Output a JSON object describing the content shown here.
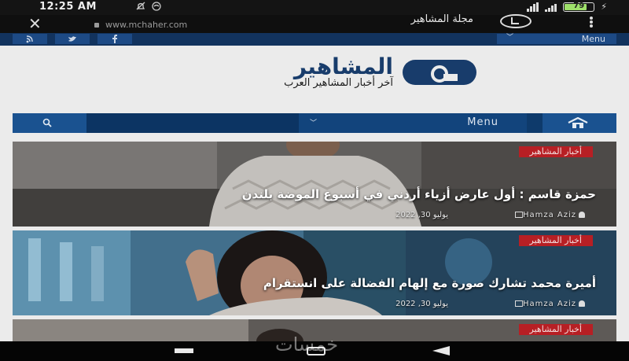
{
  "status_bar": {
    "time": "12:25 AM",
    "battery": "79",
    "battery_level": 0.79
  },
  "browser": {
    "url": "www.mchaher.com",
    "page_name": "مجلة المشاهير"
  },
  "top_strip": {
    "menu_label": "Menu",
    "social": [
      "rss-icon",
      "twitter-icon",
      "facebook-icon"
    ]
  },
  "logo": {
    "title": "المشاهير",
    "tagline": "آخر أخبار المشاهير العرب"
  },
  "main_nav": {
    "menu_label": "Menu"
  },
  "articles": [
    {
      "category": "أخبار المشاهير",
      "title": "حمزة قاسم : أول عارض أزياء أردني في أسبوع الموضة بلندن",
      "author": "Hamza Aziz",
      "date": "يوليو 30, 2022"
    },
    {
      "category": "أخبار المشاهير",
      "title": "أميرة محمد تشارك صورة مع إلهام الفضالة على انستقرام",
      "author": "Hamza Aziz",
      "date": "يوليو 30, 2022"
    },
    {
      "category": "أخبار المشاهير"
    }
  ],
  "watermark": "خمسات",
  "colors": {
    "brand_navy": "#0e3a6b",
    "badge_red": "#b71f24",
    "page_bg": "#ebebeb"
  }
}
